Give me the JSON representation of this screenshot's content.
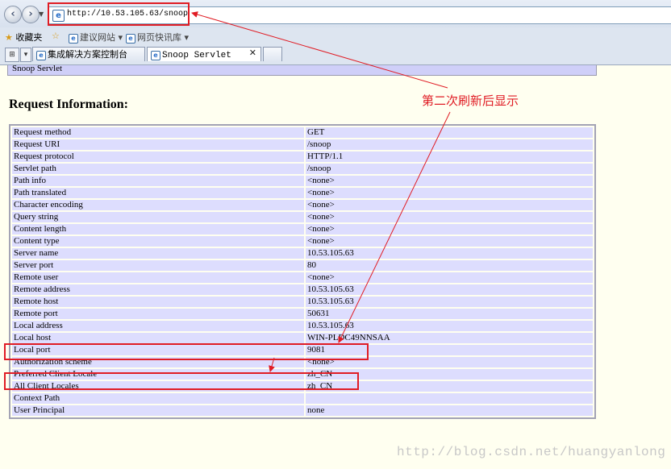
{
  "browser": {
    "address": "http://10.53.105.63/snoop",
    "back_glyph": "‹",
    "forward_glyph": "›",
    "favorites": {
      "label": "收藏夹",
      "items": [
        {
          "label": "建议网站 ▾"
        },
        {
          "label": "网页快讯库 ▾"
        }
      ]
    },
    "tabs": [
      {
        "label": "集成解决方案控制台",
        "active": false
      },
      {
        "label": "Snoop Servlet",
        "active": true
      }
    ],
    "tab_close_glyph": "✕",
    "quick_tabs_glyph": "⊞",
    "tab_list_glyph": "▾"
  },
  "page": {
    "header_label": "Snoop Servlet",
    "section_title": "Request Information:",
    "rows": [
      {
        "key": "Request method",
        "value": "GET"
      },
      {
        "key": "Request URI",
        "value": "/snoop"
      },
      {
        "key": "Request protocol",
        "value": "HTTP/1.1"
      },
      {
        "key": "Servlet path",
        "value": "/snoop"
      },
      {
        "key": "Path info",
        "value": "<none>"
      },
      {
        "key": "Path translated",
        "value": "<none>"
      },
      {
        "key": "Character encoding",
        "value": "<none>"
      },
      {
        "key": "Query string",
        "value": "<none>"
      },
      {
        "key": "Content length",
        "value": "<none>"
      },
      {
        "key": "Content type",
        "value": "<none>"
      },
      {
        "key": "Server name",
        "value": "10.53.105.63"
      },
      {
        "key": "Server port",
        "value": "80"
      },
      {
        "key": "Remote user",
        "value": "<none>"
      },
      {
        "key": "Remote address",
        "value": "10.53.105.63"
      },
      {
        "key": "Remote host",
        "value": "10.53.105.63"
      },
      {
        "key": "Remote port",
        "value": "50631"
      },
      {
        "key": "Local address",
        "value": "10.53.105.63"
      },
      {
        "key": "Local host",
        "value": "WIN-PLDC49NNSAA"
      },
      {
        "key": "Local port",
        "value": "9081"
      },
      {
        "key": "Authorization scheme",
        "value": "<none>"
      },
      {
        "key": "Preferred Client Locale",
        "value": "zh_CN"
      },
      {
        "key": "All Client Locales",
        "value": "zh_CN"
      },
      {
        "key": "Context Path",
        "value": ""
      },
      {
        "key": "User Principal",
        "value": "none"
      }
    ]
  },
  "annotation": {
    "text": "第二次刷新后显示",
    "color": "#e01c24"
  },
  "watermark": "http://blog.csdn.net/huangyanlong",
  "colors": {
    "row_bg": "#ddddfe",
    "page_bg": "#fffff0"
  }
}
